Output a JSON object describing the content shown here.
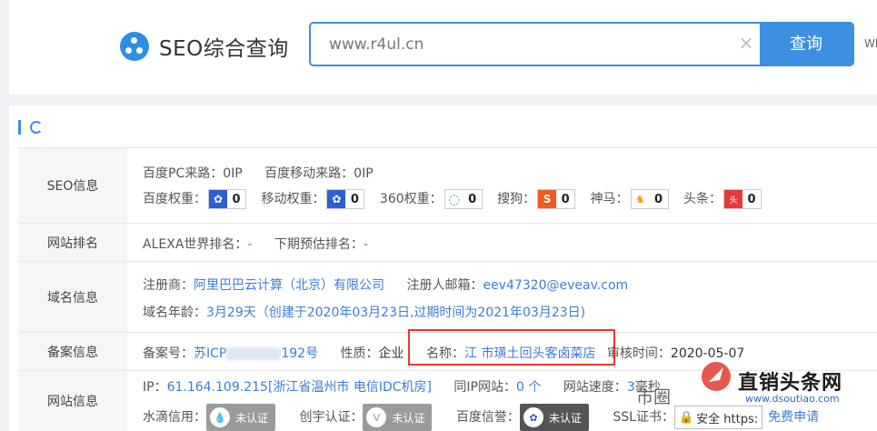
{
  "header": {
    "logo_title": "SEO综合查询",
    "search_value": "www.r4ul.cn",
    "clear_symbol": "×",
    "search_button": "查询",
    "who": "Who"
  },
  "rows": {
    "seo": {
      "label": "SEO信息",
      "baidu_pc_label": "百度PC来路：",
      "baidu_pc_value": "0IP",
      "baidu_mobile_label": "百度移动来路：",
      "baidu_mobile_value": "0IP",
      "weights": [
        {
          "label": "百度权重：",
          "value": "0",
          "icon": "baidu-paw-icon",
          "color": "#2e5fd1"
        },
        {
          "label": "移动权重：",
          "value": "0",
          "icon": "baidu-paw-icon",
          "color": "#2e5fd1"
        },
        {
          "label": "360权重：",
          "value": "0",
          "icon": "360-icon",
          "color": "#47a94a"
        },
        {
          "label": "搜狗：",
          "value": "0",
          "icon": "sogou-icon",
          "color": "#f05a24"
        },
        {
          "label": "神马：",
          "value": "0",
          "icon": "shenma-icon",
          "color": "#f29a1e"
        },
        {
          "label": "头条：",
          "value": "0",
          "icon": "toutiao-icon",
          "color": "#e53a3a"
        }
      ]
    },
    "rank": {
      "label": "网站排名",
      "alexa_label": "ALEXA世界排名：",
      "alexa_value": "-",
      "forecast_label": "下期预估排名：",
      "forecast_value": "-"
    },
    "domain": {
      "label": "域名信息",
      "registrar_label": "注册商：",
      "registrar_value": "阿里巴巴云计算（北京）有限公司",
      "email_label": "注册人邮箱：",
      "email_value": "eev47320@eveav.com",
      "age_label": "域名年龄：",
      "age_value": "3月29天（创建于2020年03月23日,过期时间为2021年03月23日)"
    },
    "beian": {
      "label": "备案信息",
      "no_label": "备案号：",
      "no_value_prefix": "苏ICP",
      "no_value_suffix": "192号",
      "nature_label": "性质：",
      "nature_value": "企业",
      "name_label": "名称：",
      "name_value": "江 市璜土回头客卤菜店",
      "audit_label": "审核时间：",
      "audit_value": "2020-05-07"
    },
    "site": {
      "label": "网站信息",
      "ip_label": "IP：",
      "ip_value": "61.164.109.215[浙江省温州市 电信IDC机房]",
      "sameip_label": "同IP网站：",
      "sameip_value": "0 个",
      "speed_label": "网站速度：",
      "speed_value": "3",
      "speed_unit": "毫秒",
      "shuidi_label": "水滴信用：",
      "shuidi_badge": "未认证",
      "chuangzi_label": "创宇认证：",
      "chuangzi_badge": "未认证",
      "baidu_trust_label": "百度信誉：",
      "baidu_trust_badge": "未认证",
      "ssl_label": "SSL证书：",
      "ssl_badge": "安全 https:",
      "ssl_apply": "免费申请"
    }
  },
  "watermark": {
    "left_text": "市圈",
    "brand": "直销头条网",
    "url": "www.dsoutiao.com"
  }
}
